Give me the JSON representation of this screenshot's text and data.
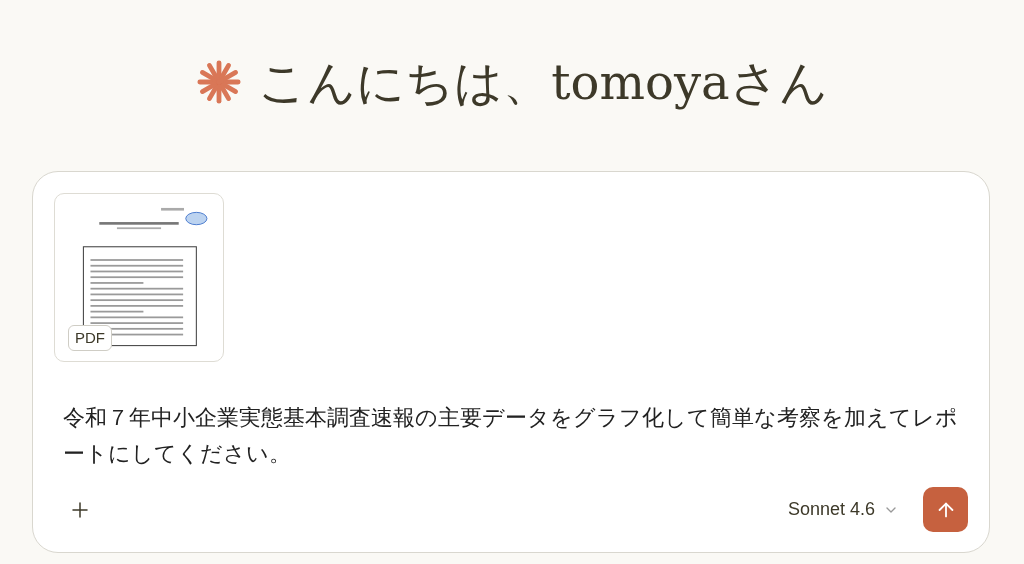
{
  "greeting": "こんにちは、tomoyaさん",
  "attachment": {
    "badge": "PDF"
  },
  "message": {
    "value": "令和７年中小企業実態基本調査速報の主要データをグラフ化して簡単な考察を加えてレポートにしてください。"
  },
  "model_selector": {
    "label": "Sonnet 4.6"
  }
}
